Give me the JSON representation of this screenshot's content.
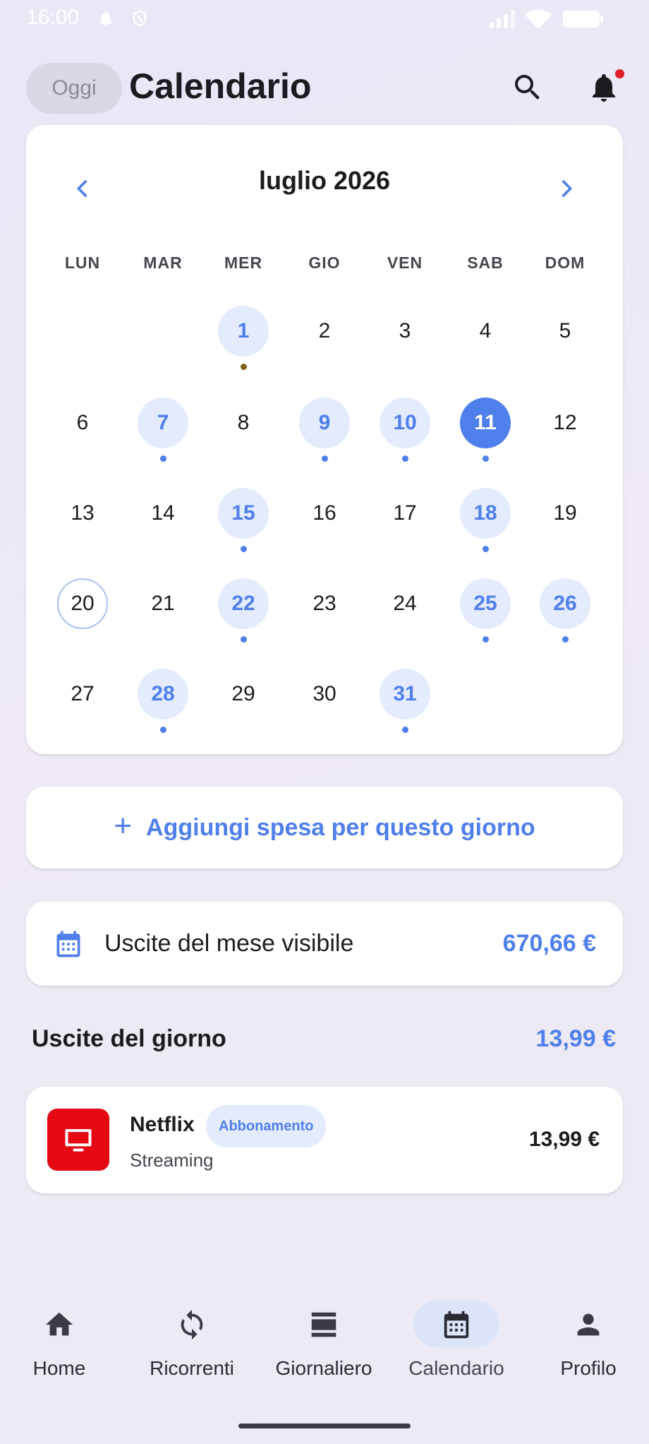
{
  "status_bar": {
    "time": "16:00"
  },
  "header": {
    "today_label": "Oggi",
    "title": "Calendario"
  },
  "calendar": {
    "month_label": "luglio 2026",
    "weekdays": [
      "LUN",
      "MAR",
      "MER",
      "GIO",
      "VEN",
      "SAB",
      "DOM"
    ],
    "days": [
      "1",
      "2",
      "3",
      "4",
      "5",
      "6",
      "7",
      "8",
      "9",
      "10",
      "11",
      "12",
      "13",
      "14",
      "15",
      "16",
      "17",
      "18",
      "19",
      "20",
      "21",
      "22",
      "23",
      "24",
      "25",
      "26",
      "27",
      "28",
      "29",
      "30",
      "31"
    ],
    "days_with_expenses": [
      1,
      7,
      9,
      10,
      11,
      15,
      18,
      22,
      25,
      26,
      28,
      31
    ],
    "selected_day": 11,
    "today": 20,
    "accent_color": "#4f7fea"
  },
  "add_expense": {
    "label": "Aggiungi spesa per questo giorno"
  },
  "month_summary": {
    "icon": "calendar-icon",
    "label": "Uscite del mese visibile",
    "value": "670,66 €"
  },
  "day_expenses": {
    "title": "Uscite del giorno",
    "total": "13,99 €",
    "items": [
      {
        "icon": "tv-icon",
        "name": "Netflix",
        "badge": "Abbonamento",
        "category": "Streaming",
        "amount": "13,99 €"
      }
    ]
  },
  "bottom_nav": [
    {
      "label": "Home",
      "icon": "home-icon"
    },
    {
      "label": "Ricorrenti",
      "icon": "sync-icon"
    },
    {
      "label": "Giornaliero",
      "icon": "view-agenda-icon"
    },
    {
      "label": "Calendario",
      "icon": "calendar-icon",
      "active": true
    },
    {
      "label": "Profilo",
      "icon": "person-icon"
    }
  ]
}
